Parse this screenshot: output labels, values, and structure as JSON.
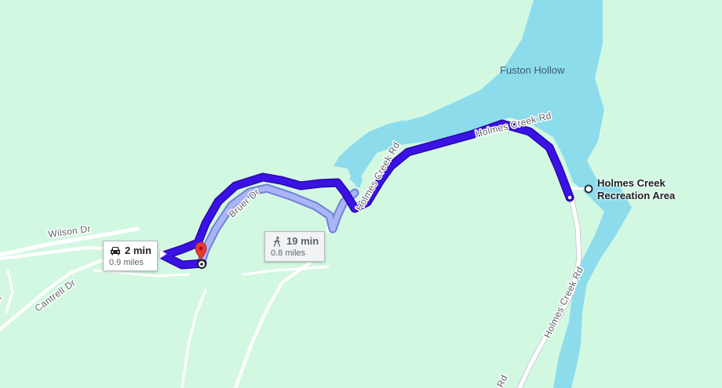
{
  "map": {
    "colors": {
      "land": "#d3f8e2",
      "water": "#8ddcec",
      "road": "#ffffff",
      "road_casing": "#c9ccd0",
      "route_primary": "#3b12e6",
      "route_primary_edge": "#2a06a8",
      "route_alternate": "#aab4f6",
      "route_alternate_edge": "#6f82d8",
      "pin": "#e53935"
    },
    "places": [
      {
        "id": "fuston-hollow",
        "label": "Fuston Hollow"
      }
    ],
    "destination": {
      "line1": "Holmes Creek",
      "line2": "Recreation Area"
    },
    "roads": {
      "wilson": "Wilson Dr",
      "cantrell": "Cantrell Dr",
      "bruer": "Bruer Dr",
      "holmes_upper": "Holmes Creek Rd",
      "holmes_upper2": "Holmes Creek Rd",
      "holmes_lower": "Holmes Creek Rd",
      "bottom_fragment": "Rd",
      "left_fragment": "Dr"
    },
    "routes": [
      {
        "mode": "driving",
        "icon": "car-icon",
        "time": "2 min",
        "distance": "0.9 miles",
        "selected": true
      },
      {
        "mode": "walking",
        "icon": "walking-person-icon",
        "time": "19 min",
        "distance": "0.8 miles",
        "selected": false
      }
    ]
  }
}
